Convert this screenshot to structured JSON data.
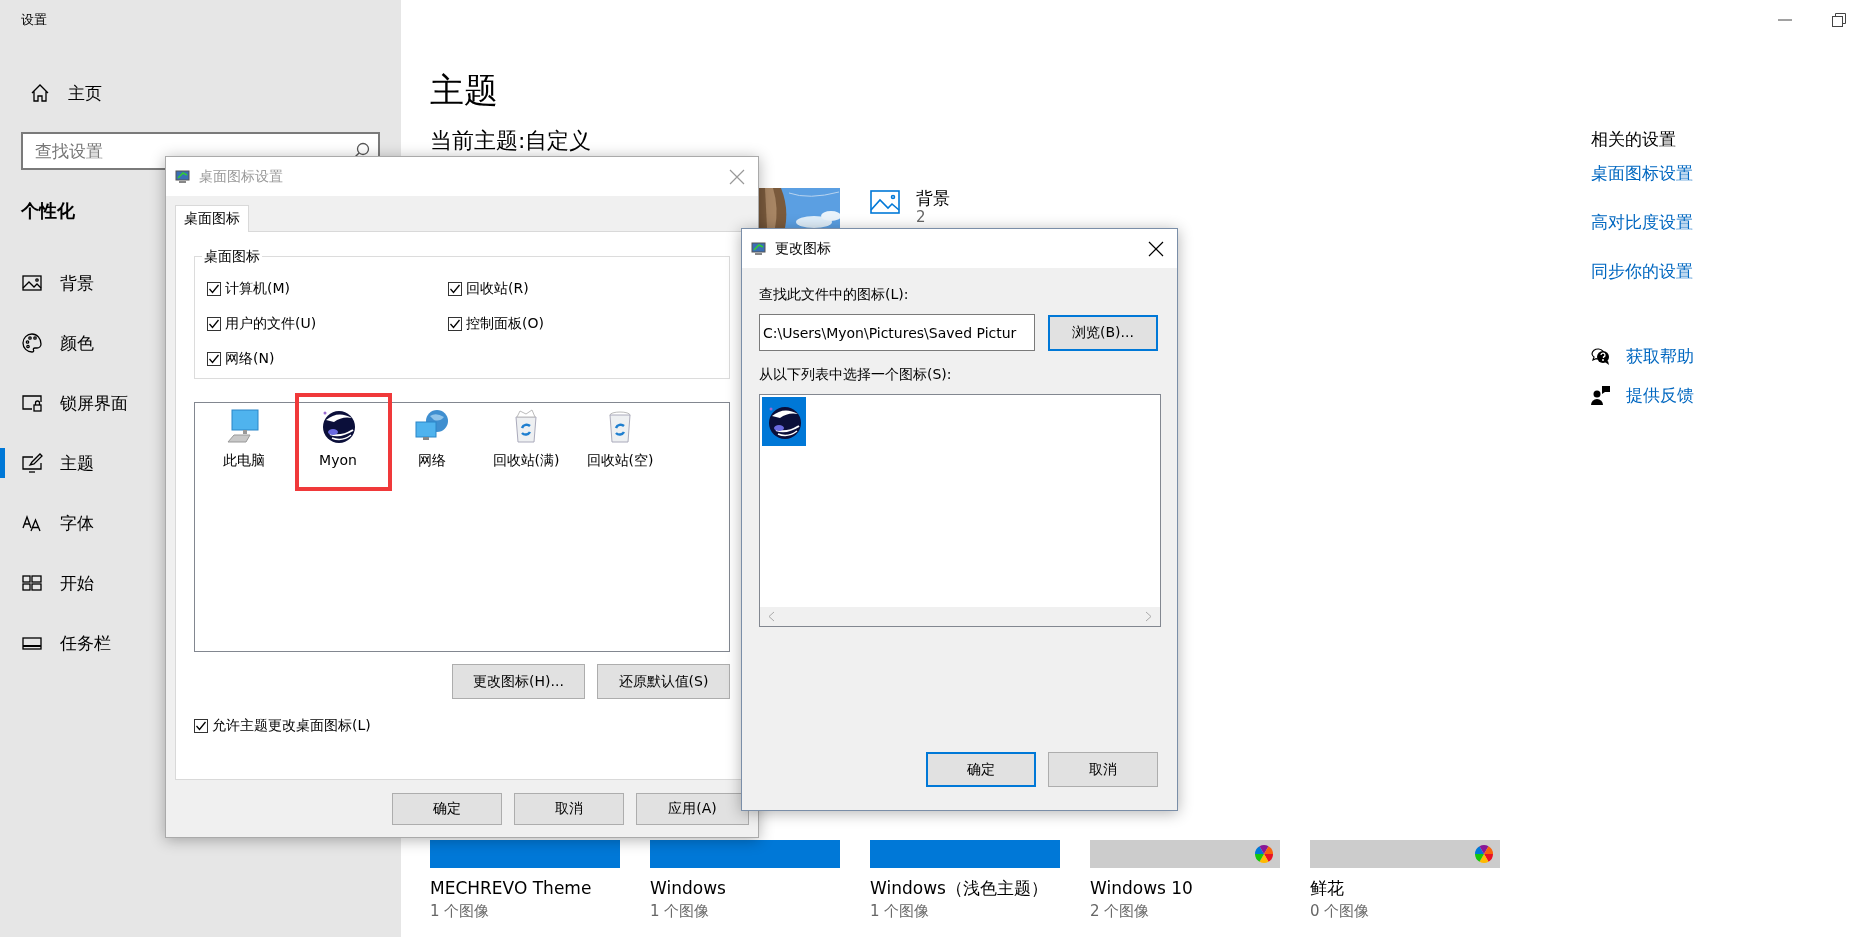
{
  "window": {
    "title": "设置"
  },
  "sidebar": {
    "home": "主页",
    "search": {
      "placeholder": "查找设置"
    },
    "section": "个性化",
    "items": [
      {
        "label": "背景",
        "selected": false
      },
      {
        "label": "颜色",
        "selected": false
      },
      {
        "label": "锁屏界面",
        "selected": false
      },
      {
        "label": "主题",
        "selected": true
      },
      {
        "label": "字体",
        "selected": false
      },
      {
        "label": "开始",
        "selected": false
      },
      {
        "label": "任务栏",
        "selected": false
      }
    ]
  },
  "main": {
    "title": "主题",
    "current_theme": "当前主题:自定义",
    "background": {
      "label": "背景",
      "value": "2"
    },
    "related": {
      "title": "相关的设置",
      "links": [
        "桌面图标设置",
        "高对比度设置",
        "同步你的设置"
      ]
    },
    "help": [
      {
        "kind": "help",
        "label": "获取帮助"
      },
      {
        "kind": "feedback",
        "label": "提供反馈"
      }
    ],
    "themes": [
      {
        "name": "MECHREVO Theme",
        "count": "1 个图像",
        "color": "#0078d7",
        "color_wheel": false
      },
      {
        "name": "Windows",
        "count": "1 个图像",
        "color": "#0078d7",
        "color_wheel": false
      },
      {
        "name": "Windows（浅色主题）",
        "count": "1 个图像",
        "color": "#0078d7",
        "color_wheel": false
      },
      {
        "name": "Windows 10",
        "count": "2 个图像",
        "color": "#cccccc",
        "color_wheel": true
      },
      {
        "name": "鲜花",
        "count": "0 个图像",
        "color": "#cccccc",
        "color_wheel": true
      }
    ]
  },
  "desktop_icons_dialog": {
    "title": "桌面图标设置",
    "active": false,
    "tabs": [
      {
        "label": "桌面图标",
        "selected": true
      }
    ],
    "group": {
      "title": "桌面图标",
      "checkboxes": [
        {
          "label": "计算机(M)",
          "checked": true
        },
        {
          "label": "回收站(R)",
          "checked": true
        },
        {
          "label": "用户的文件(U)",
          "checked": true
        },
        {
          "label": "控制面板(O)",
          "checked": true
        },
        {
          "label": "网络(N)",
          "checked": true
        }
      ]
    },
    "icons": [
      {
        "kind": "computer",
        "label": "此电脑",
        "highlighted": false
      },
      {
        "kind": "custom",
        "label": "Myon",
        "highlighted": true
      },
      {
        "kind": "network",
        "label": "网络",
        "highlighted": false
      },
      {
        "kind": "bin_full",
        "label": "回收站(满)",
        "highlighted": false
      },
      {
        "kind": "bin_empty",
        "label": "回收站(空)",
        "highlighted": false
      }
    ],
    "buttons": [
      "更改图标(H)...",
      "还原默认值(S)"
    ],
    "allow": {
      "label": "允许主题更改桌面图标(L)",
      "checked": true
    },
    "footer_buttons": [
      "确定",
      "取消",
      "应用(A)"
    ]
  },
  "change_icon_dialog": {
    "title": "更改图标",
    "active": true,
    "file_label": "查找此文件中的图标(L):",
    "file_path": "C:\\Users\\Myon\\Pictures\\Saved Pictur",
    "browse": {
      "label": "浏览(B)...",
      "focused": true
    },
    "list_label": "从以下列表中选择一个图标(S):",
    "icons": [
      {
        "selected": true
      }
    ],
    "buttons": [
      {
        "label": "确定",
        "default": true
      },
      {
        "label": "取消",
        "default": false
      }
    ]
  }
}
